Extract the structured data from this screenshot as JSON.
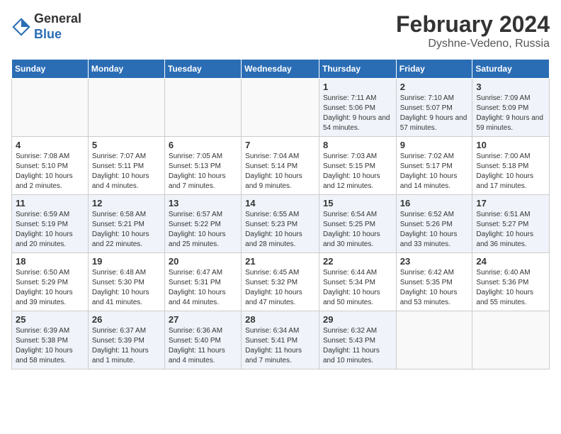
{
  "header": {
    "logo_general": "General",
    "logo_blue": "Blue",
    "month_year": "February 2024",
    "location": "Dyshne-Vedeno, Russia"
  },
  "days_of_week": [
    "Sunday",
    "Monday",
    "Tuesday",
    "Wednesday",
    "Thursday",
    "Friday",
    "Saturday"
  ],
  "weeks": [
    [
      {
        "day": "",
        "info": ""
      },
      {
        "day": "",
        "info": ""
      },
      {
        "day": "",
        "info": ""
      },
      {
        "day": "",
        "info": ""
      },
      {
        "day": "1",
        "info": "Sunrise: 7:11 AM\nSunset: 5:06 PM\nDaylight: 9 hours and 54 minutes."
      },
      {
        "day": "2",
        "info": "Sunrise: 7:10 AM\nSunset: 5:07 PM\nDaylight: 9 hours and 57 minutes."
      },
      {
        "day": "3",
        "info": "Sunrise: 7:09 AM\nSunset: 5:09 PM\nDaylight: 9 hours and 59 minutes."
      }
    ],
    [
      {
        "day": "4",
        "info": "Sunrise: 7:08 AM\nSunset: 5:10 PM\nDaylight: 10 hours and 2 minutes."
      },
      {
        "day": "5",
        "info": "Sunrise: 7:07 AM\nSunset: 5:11 PM\nDaylight: 10 hours and 4 minutes."
      },
      {
        "day": "6",
        "info": "Sunrise: 7:05 AM\nSunset: 5:13 PM\nDaylight: 10 hours and 7 minutes."
      },
      {
        "day": "7",
        "info": "Sunrise: 7:04 AM\nSunset: 5:14 PM\nDaylight: 10 hours and 9 minutes."
      },
      {
        "day": "8",
        "info": "Sunrise: 7:03 AM\nSunset: 5:15 PM\nDaylight: 10 hours and 12 minutes."
      },
      {
        "day": "9",
        "info": "Sunrise: 7:02 AM\nSunset: 5:17 PM\nDaylight: 10 hours and 14 minutes."
      },
      {
        "day": "10",
        "info": "Sunrise: 7:00 AM\nSunset: 5:18 PM\nDaylight: 10 hours and 17 minutes."
      }
    ],
    [
      {
        "day": "11",
        "info": "Sunrise: 6:59 AM\nSunset: 5:19 PM\nDaylight: 10 hours and 20 minutes."
      },
      {
        "day": "12",
        "info": "Sunrise: 6:58 AM\nSunset: 5:21 PM\nDaylight: 10 hours and 22 minutes."
      },
      {
        "day": "13",
        "info": "Sunrise: 6:57 AM\nSunset: 5:22 PM\nDaylight: 10 hours and 25 minutes."
      },
      {
        "day": "14",
        "info": "Sunrise: 6:55 AM\nSunset: 5:23 PM\nDaylight: 10 hours and 28 minutes."
      },
      {
        "day": "15",
        "info": "Sunrise: 6:54 AM\nSunset: 5:25 PM\nDaylight: 10 hours and 30 minutes."
      },
      {
        "day": "16",
        "info": "Sunrise: 6:52 AM\nSunset: 5:26 PM\nDaylight: 10 hours and 33 minutes."
      },
      {
        "day": "17",
        "info": "Sunrise: 6:51 AM\nSunset: 5:27 PM\nDaylight: 10 hours and 36 minutes."
      }
    ],
    [
      {
        "day": "18",
        "info": "Sunrise: 6:50 AM\nSunset: 5:29 PM\nDaylight: 10 hours and 39 minutes."
      },
      {
        "day": "19",
        "info": "Sunrise: 6:48 AM\nSunset: 5:30 PM\nDaylight: 10 hours and 41 minutes."
      },
      {
        "day": "20",
        "info": "Sunrise: 6:47 AM\nSunset: 5:31 PM\nDaylight: 10 hours and 44 minutes."
      },
      {
        "day": "21",
        "info": "Sunrise: 6:45 AM\nSunset: 5:32 PM\nDaylight: 10 hours and 47 minutes."
      },
      {
        "day": "22",
        "info": "Sunrise: 6:44 AM\nSunset: 5:34 PM\nDaylight: 10 hours and 50 minutes."
      },
      {
        "day": "23",
        "info": "Sunrise: 6:42 AM\nSunset: 5:35 PM\nDaylight: 10 hours and 53 minutes."
      },
      {
        "day": "24",
        "info": "Sunrise: 6:40 AM\nSunset: 5:36 PM\nDaylight: 10 hours and 55 minutes."
      }
    ],
    [
      {
        "day": "25",
        "info": "Sunrise: 6:39 AM\nSunset: 5:38 PM\nDaylight: 10 hours and 58 minutes."
      },
      {
        "day": "26",
        "info": "Sunrise: 6:37 AM\nSunset: 5:39 PM\nDaylight: 11 hours and 1 minute."
      },
      {
        "day": "27",
        "info": "Sunrise: 6:36 AM\nSunset: 5:40 PM\nDaylight: 11 hours and 4 minutes."
      },
      {
        "day": "28",
        "info": "Sunrise: 6:34 AM\nSunset: 5:41 PM\nDaylight: 11 hours and 7 minutes."
      },
      {
        "day": "29",
        "info": "Sunrise: 6:32 AM\nSunset: 5:43 PM\nDaylight: 11 hours and 10 minutes."
      },
      {
        "day": "",
        "info": ""
      },
      {
        "day": "",
        "info": ""
      }
    ]
  ]
}
